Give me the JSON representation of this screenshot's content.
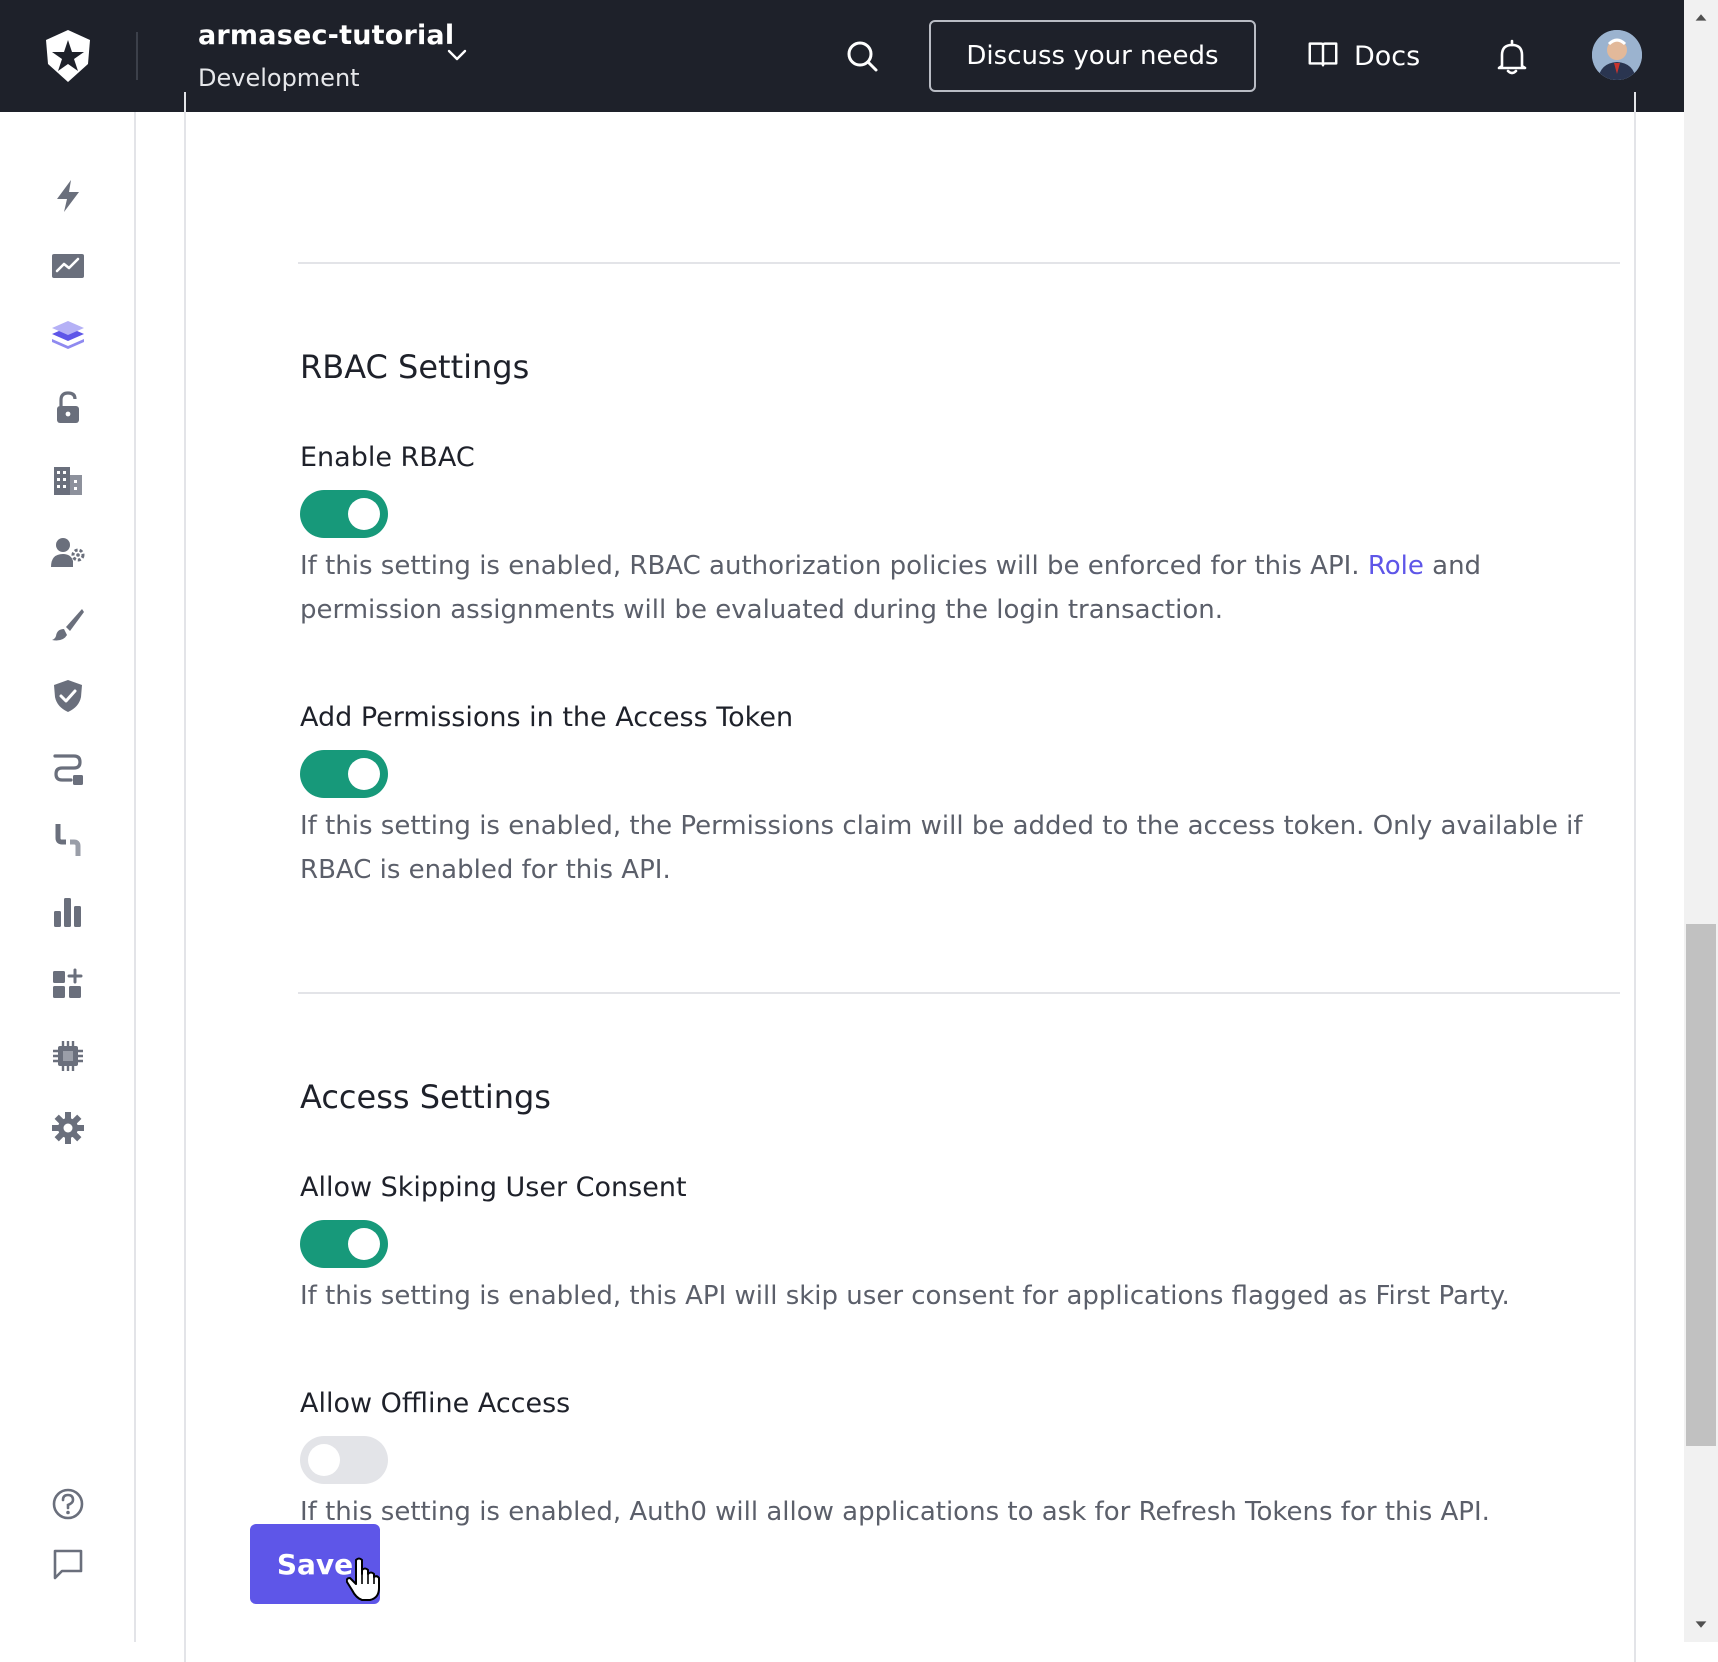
{
  "header": {
    "tenant_name": "armasec-tutorial",
    "tenant_environment": "Development",
    "discuss_button": "Discuss your needs",
    "docs_label": "Docs"
  },
  "sidebar": {
    "items": [
      {
        "name": "getting-started",
        "icon": "lightning-icon"
      },
      {
        "name": "activity",
        "icon": "trending-chart-icon"
      },
      {
        "name": "applications",
        "icon": "layers-icon",
        "active": true
      },
      {
        "name": "authentication",
        "icon": "unlock-icon"
      },
      {
        "name": "organizations",
        "icon": "building-icon"
      },
      {
        "name": "user-management",
        "icon": "user-gear-icon"
      },
      {
        "name": "branding",
        "icon": "brush-icon"
      },
      {
        "name": "security",
        "icon": "shield-check-icon"
      },
      {
        "name": "actions",
        "icon": "flow-icon"
      },
      {
        "name": "auth-pipeline",
        "icon": "pipe-icon"
      },
      {
        "name": "monitoring",
        "icon": "bar-chart-icon"
      },
      {
        "name": "marketplace",
        "icon": "add-apps-icon"
      },
      {
        "name": "extensions",
        "icon": "chip-icon"
      },
      {
        "name": "settings",
        "icon": "gear-icon"
      }
    ],
    "bottom": [
      {
        "name": "help",
        "icon": "question-circle-icon"
      },
      {
        "name": "feedback",
        "icon": "chat-bubble-icon"
      }
    ],
    "accent_color": "#5e56e8"
  },
  "rbac": {
    "title": "RBAC Settings",
    "enable_rbac": {
      "label": "Enable RBAC",
      "enabled": true,
      "help_before": "If this setting is enabled, RBAC authorization policies will be enforced for this API.",
      "help_link": "Role",
      "help_after": "and permission assignments will be evaluated during the login transaction."
    },
    "add_permissions": {
      "label": "Add Permissions in the Access Token",
      "enabled": true,
      "help": "If this setting is enabled, the Permissions claim will be added to the access token. Only available if RBAC is enabled for this API."
    }
  },
  "access": {
    "title": "Access Settings",
    "skip_consent": {
      "label": "Allow Skipping User Consent",
      "enabled": true,
      "help": "If this setting is enabled, this API will skip user consent for applications flagged as First Party."
    },
    "offline_access": {
      "label": "Allow Offline Access",
      "enabled": false,
      "help": "If this setting is enabled, Auth0 will allow applications to ask for Refresh Tokens for this API."
    }
  },
  "save_label": "Save",
  "colors": {
    "topbar": "#1e212a",
    "toggle_on": "#17997a",
    "toggle_off": "#e3e4e8",
    "primary_button": "#5e56e8",
    "link": "#5e56e8"
  }
}
